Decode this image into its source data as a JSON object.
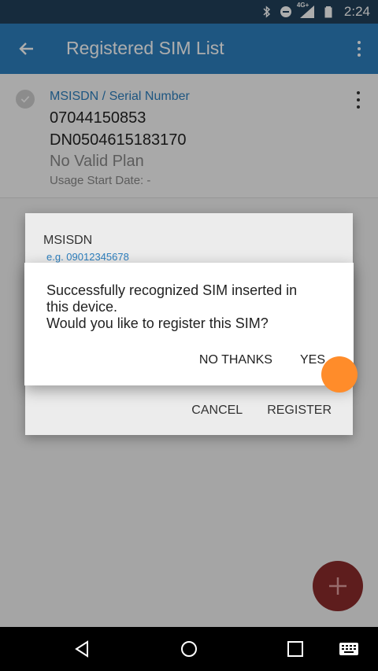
{
  "status_bar": {
    "time": "2:24",
    "network_label": "4G+",
    "icons": [
      "bluetooth-icon",
      "do-not-disturb-icon",
      "signal-icon",
      "battery-icon"
    ]
  },
  "app_bar": {
    "title": "Registered SIM List",
    "back_icon": "arrow-back-icon",
    "menu_icon": "more-vert-icon"
  },
  "sim_list": [
    {
      "header": "MSISDN / Serial Number",
      "msisdn": "07044150853",
      "serial": "DN0504615183170",
      "plan": "No Valid Plan",
      "usage": "Usage Start Date: -"
    }
  ],
  "register_dialog": {
    "field_label": "MSISDN",
    "field_hint": "e.g. 09012345678",
    "cancel_label": "CANCEL",
    "register_label": "REGISTER"
  },
  "confirm_dialog": {
    "message_line1": "Successfully recognized SIM inserted in",
    "message_line2": "this device.",
    "message_line3": "Would you like to register this SIM?",
    "no_label": "NO THANKS",
    "yes_label": "YES"
  },
  "fab": {
    "icon": "add-icon"
  },
  "nav_bar": {
    "icons": [
      "back-nav-icon",
      "home-nav-icon",
      "recents-nav-icon",
      "keyboard-icon"
    ]
  },
  "colors": {
    "primary": "#2d7fbe",
    "status_bar": "#21405a",
    "fab": "#c73a3a",
    "touch_indicator": "#ff8c2a"
  }
}
